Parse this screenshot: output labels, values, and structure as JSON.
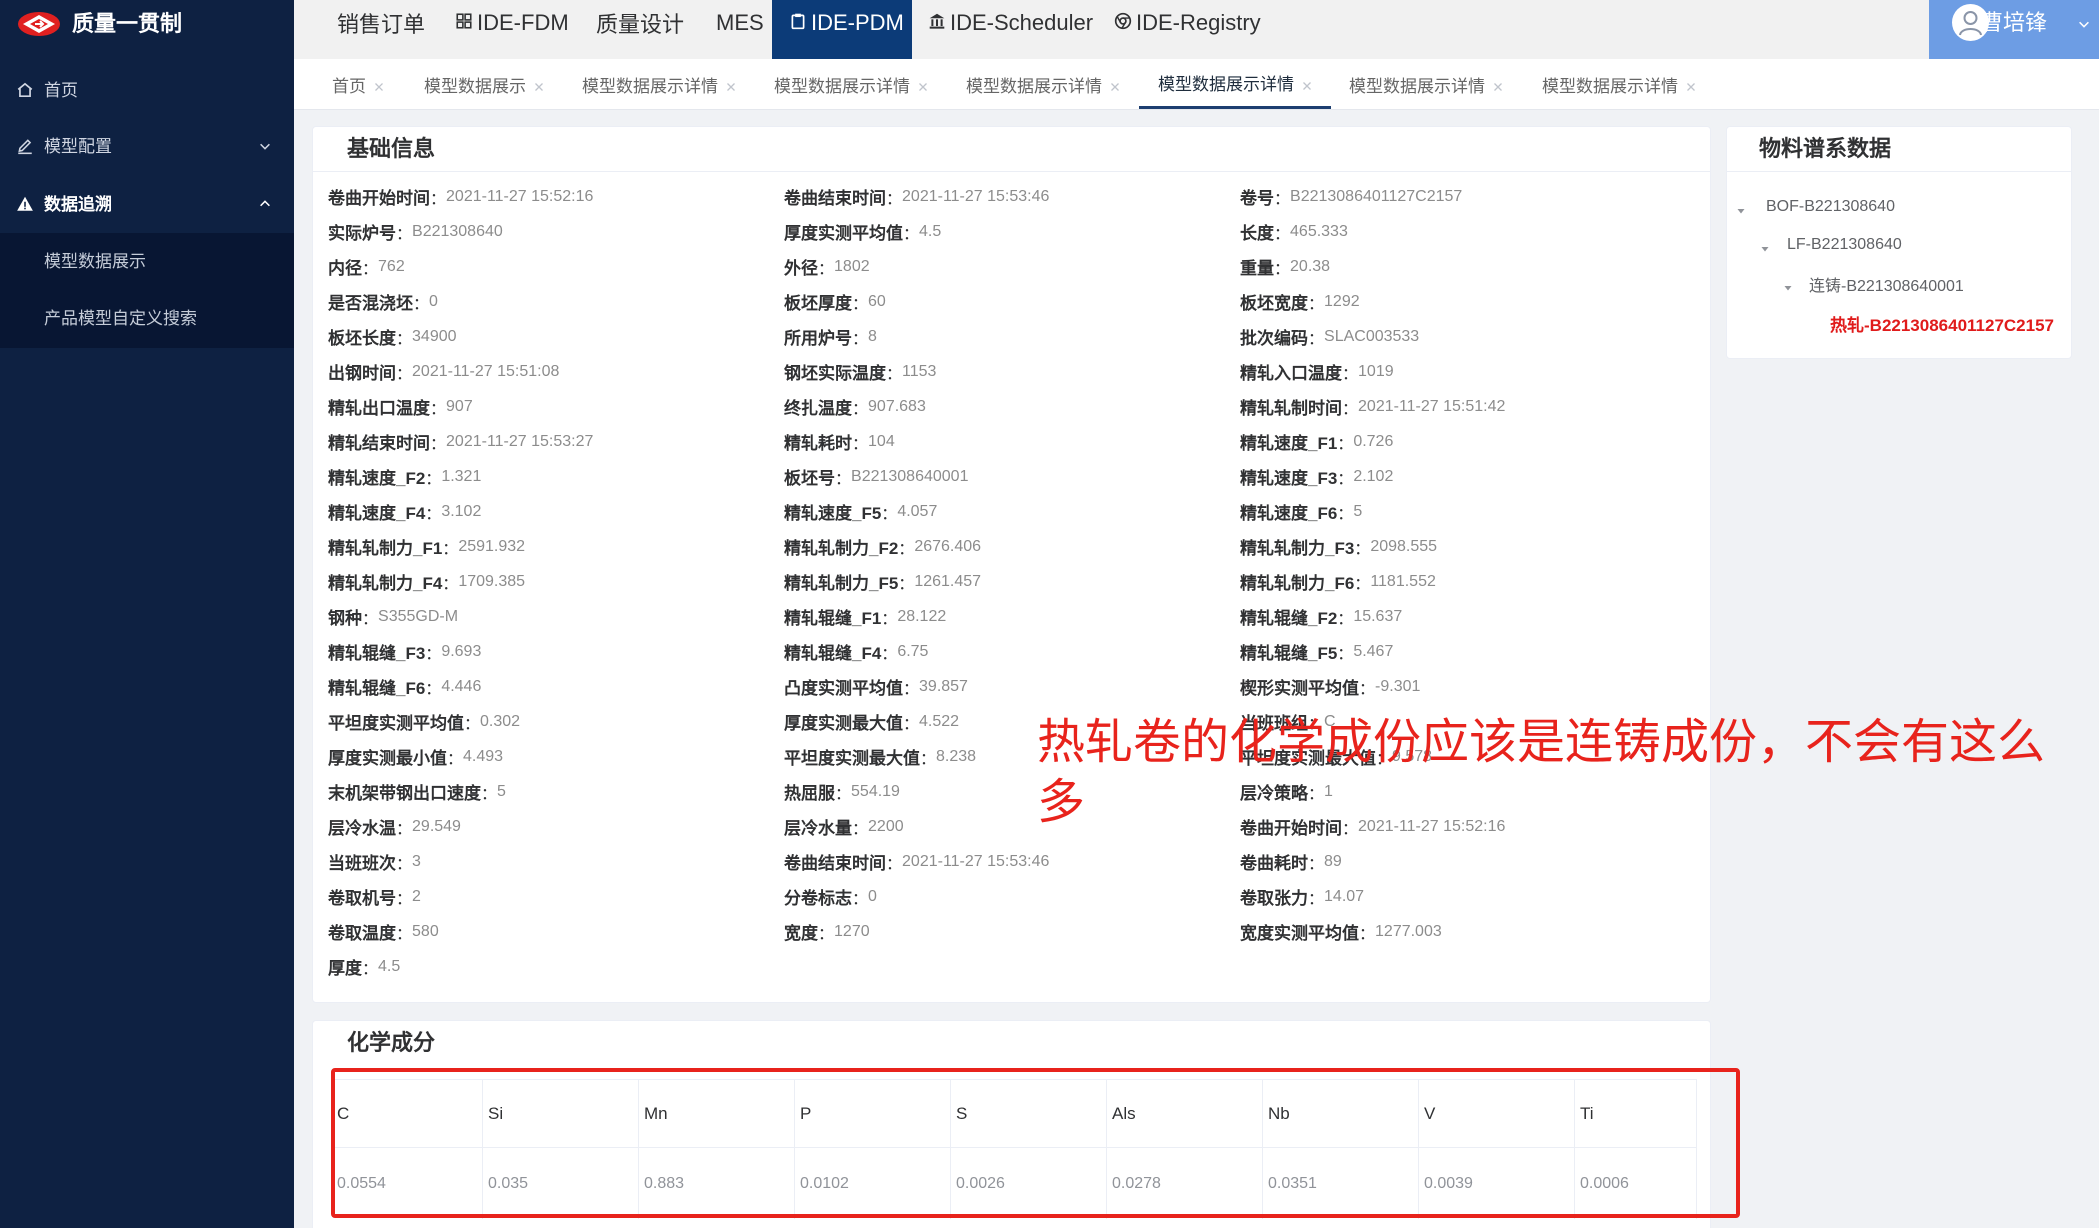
{
  "sidebar": {
    "logo_text": "质量一贯制",
    "logo_icon": "brand-logo-icon",
    "items": [
      {
        "label": "首页",
        "icon": "home-icon"
      },
      {
        "label": "模型配置",
        "icon": "edit-icon",
        "chevron": "chevron-down-icon"
      },
      {
        "label": "数据追溯",
        "icon": "warning-triangle-icon",
        "chevron": "chevron-up-icon",
        "active": true,
        "children": [
          {
            "label": "模型数据展示"
          },
          {
            "label": "产品模型自定义搜索"
          }
        ]
      }
    ]
  },
  "topnav": {
    "items": [
      {
        "label": "销售订单"
      },
      {
        "label": "IDE-FDM",
        "icon": "grid-icon"
      },
      {
        "label": "质量设计"
      },
      {
        "label": "MES"
      },
      {
        "label": "IDE-PDM",
        "icon": "clipboard-icon",
        "active": true
      },
      {
        "label": "IDE-Scheduler",
        "icon": "bank-icon"
      },
      {
        "label": "IDE-Registry",
        "icon": "chrome-icon"
      }
    ],
    "user": {
      "name": "曹培锋",
      "icon": "user-avatar-icon"
    }
  },
  "tabs": {
    "active_index": 5,
    "items": [
      {
        "label": "首页"
      },
      {
        "label": "模型数据展示"
      },
      {
        "label": "模型数据展示详情"
      },
      {
        "label": "模型数据展示详情"
      },
      {
        "label": "模型数据展示详情"
      },
      {
        "label": "模型数据展示详情"
      },
      {
        "label": "模型数据展示详情"
      },
      {
        "label": "模型数据展示详情"
      }
    ]
  },
  "basic_info": {
    "title": "基础信息",
    "separator": "：",
    "fields": [
      {
        "label": "卷曲开始时间",
        "value": "2021-11-27 15:52:16"
      },
      {
        "label": "卷曲结束时间",
        "value": "2021-11-27 15:53:46"
      },
      {
        "label": "卷号",
        "value": "B2213086401127C2157"
      },
      {
        "label": "实际炉号",
        "value": "B221308640"
      },
      {
        "label": "厚度实测平均值",
        "value": "4.5"
      },
      {
        "label": "长度",
        "value": "465.333"
      },
      {
        "label": "内径",
        "value": "762"
      },
      {
        "label": "外径",
        "value": "1802"
      },
      {
        "label": "重量",
        "value": "20.38"
      },
      {
        "label": "是否混浇坯",
        "value": "0"
      },
      {
        "label": "板坯厚度",
        "value": "60"
      },
      {
        "label": "板坯宽度",
        "value": "1292"
      },
      {
        "label": "板坯长度",
        "value": "34900"
      },
      {
        "label": "所用炉号",
        "value": "8"
      },
      {
        "label": "批次编码",
        "value": "SLAC003533"
      },
      {
        "label": "出钢时间",
        "value": "2021-11-27 15:51:08"
      },
      {
        "label": "钢坯实际温度",
        "value": "1153"
      },
      {
        "label": "精轧入口温度",
        "value": "1019"
      },
      {
        "label": "精轧出口温度",
        "value": "907"
      },
      {
        "label": "终扎温度",
        "value": "907.683"
      },
      {
        "label": "精轧轧制时间",
        "value": "2021-11-27 15:51:42"
      },
      {
        "label": "精轧结束时间",
        "value": "2021-11-27 15:53:27"
      },
      {
        "label": "精轧耗时",
        "value": "104"
      },
      {
        "label": "精轧速度_F1",
        "value": "0.726"
      },
      {
        "label": "精轧速度_F2",
        "value": "1.321"
      },
      {
        "label": "板坯号",
        "value": "B221308640001"
      },
      {
        "label": "精轧速度_F3",
        "value": "2.102"
      },
      {
        "label": "精轧速度_F4",
        "value": "3.102"
      },
      {
        "label": "精轧速度_F5",
        "value": "4.057"
      },
      {
        "label": "精轧速度_F6",
        "value": "5"
      },
      {
        "label": "精轧轧制力_F1",
        "value": "2591.932"
      },
      {
        "label": "精轧轧制力_F2",
        "value": "2676.406"
      },
      {
        "label": "精轧轧制力_F3",
        "value": "2098.555"
      },
      {
        "label": "精轧轧制力_F4",
        "value": "1709.385"
      },
      {
        "label": "精轧轧制力_F5",
        "value": "1261.457"
      },
      {
        "label": "精轧轧制力_F6",
        "value": "1181.552"
      },
      {
        "label": "钢种",
        "value": "S355GD-M"
      },
      {
        "label": "精轧辊缝_F1",
        "value": "28.122"
      },
      {
        "label": "精轧辊缝_F2",
        "value": "15.637"
      },
      {
        "label": "精轧辊缝_F3",
        "value": "9.693"
      },
      {
        "label": "精轧辊缝_F4",
        "value": "6.75"
      },
      {
        "label": "精轧辊缝_F5",
        "value": "5.467"
      },
      {
        "label": "精轧辊缝_F6",
        "value": "4.446"
      },
      {
        "label": "凸度实测平均值",
        "value": "39.857"
      },
      {
        "label": "楔形实测平均值",
        "value": "-9.301"
      },
      {
        "label": "平坦度实测平均值",
        "value": "0.302"
      },
      {
        "label": "厚度实测最大值",
        "value": "4.522"
      },
      {
        "label": "当班班组",
        "value": "C"
      },
      {
        "label": "厚度实测最小值",
        "value": "4.493"
      },
      {
        "label": "平坦度实测最大值",
        "value": "8.238"
      },
      {
        "label": "平坦度实测最大值",
        "value": "9.578"
      },
      {
        "label": "末机架带钢出口速度",
        "value": "5"
      },
      {
        "label": "热屈服",
        "value": "554.19"
      },
      {
        "label": "层冷策略",
        "value": "1"
      },
      {
        "label": "层冷水温",
        "value": "29.549"
      },
      {
        "label": "层冷水量",
        "value": "2200"
      },
      {
        "label": "卷曲开始时间",
        "value": "2021-11-27 15:52:16"
      },
      {
        "label": "当班班次",
        "value": "3"
      },
      {
        "label": "卷曲结束时间",
        "value": "2021-11-27 15:53:46"
      },
      {
        "label": "卷曲耗时",
        "value": "89"
      },
      {
        "label": "卷取机号",
        "value": "2"
      },
      {
        "label": "分卷标志",
        "value": "0"
      },
      {
        "label": "卷取张力",
        "value": "14.07"
      },
      {
        "label": "卷取温度",
        "value": "580"
      },
      {
        "label": "宽度",
        "value": "1270"
      },
      {
        "label": "宽度实测平均值",
        "value": "1277.003"
      },
      {
        "label": "厚度",
        "value": "4.5"
      }
    ]
  },
  "lineage": {
    "title": "物料谱系数据",
    "nodes": [
      {
        "label": "BOF-B221308640",
        "expanded": true
      },
      {
        "label": "LF-B221308640",
        "expanded": true
      },
      {
        "label": "连铸-B221308640001",
        "expanded": true
      },
      {
        "label": "热轧-B2213086401127C2157",
        "current": true
      }
    ]
  },
  "chemistry": {
    "title": "化学成分",
    "columns": [
      "C",
      "Si",
      "Mn",
      "P",
      "S",
      "Als",
      "Nb",
      "V",
      "Ti"
    ],
    "rows": [
      [
        "0.0554",
        "0.035",
        "0.883",
        "0.0102",
        "0.0026",
        "0.0278",
        "0.0351",
        "0.0039",
        "0.0006"
      ]
    ]
  },
  "annotation": {
    "text": "热轧卷的化学成份应该是连铸成份，不会有这么多"
  },
  "colors": {
    "sidebar_bg": "#0e2142",
    "active_nav_bg": "#0c3b78",
    "user_box_bg": "#6d9de4",
    "annotation_red": "#e8231c",
    "current_node_red": "#e01b1b"
  }
}
